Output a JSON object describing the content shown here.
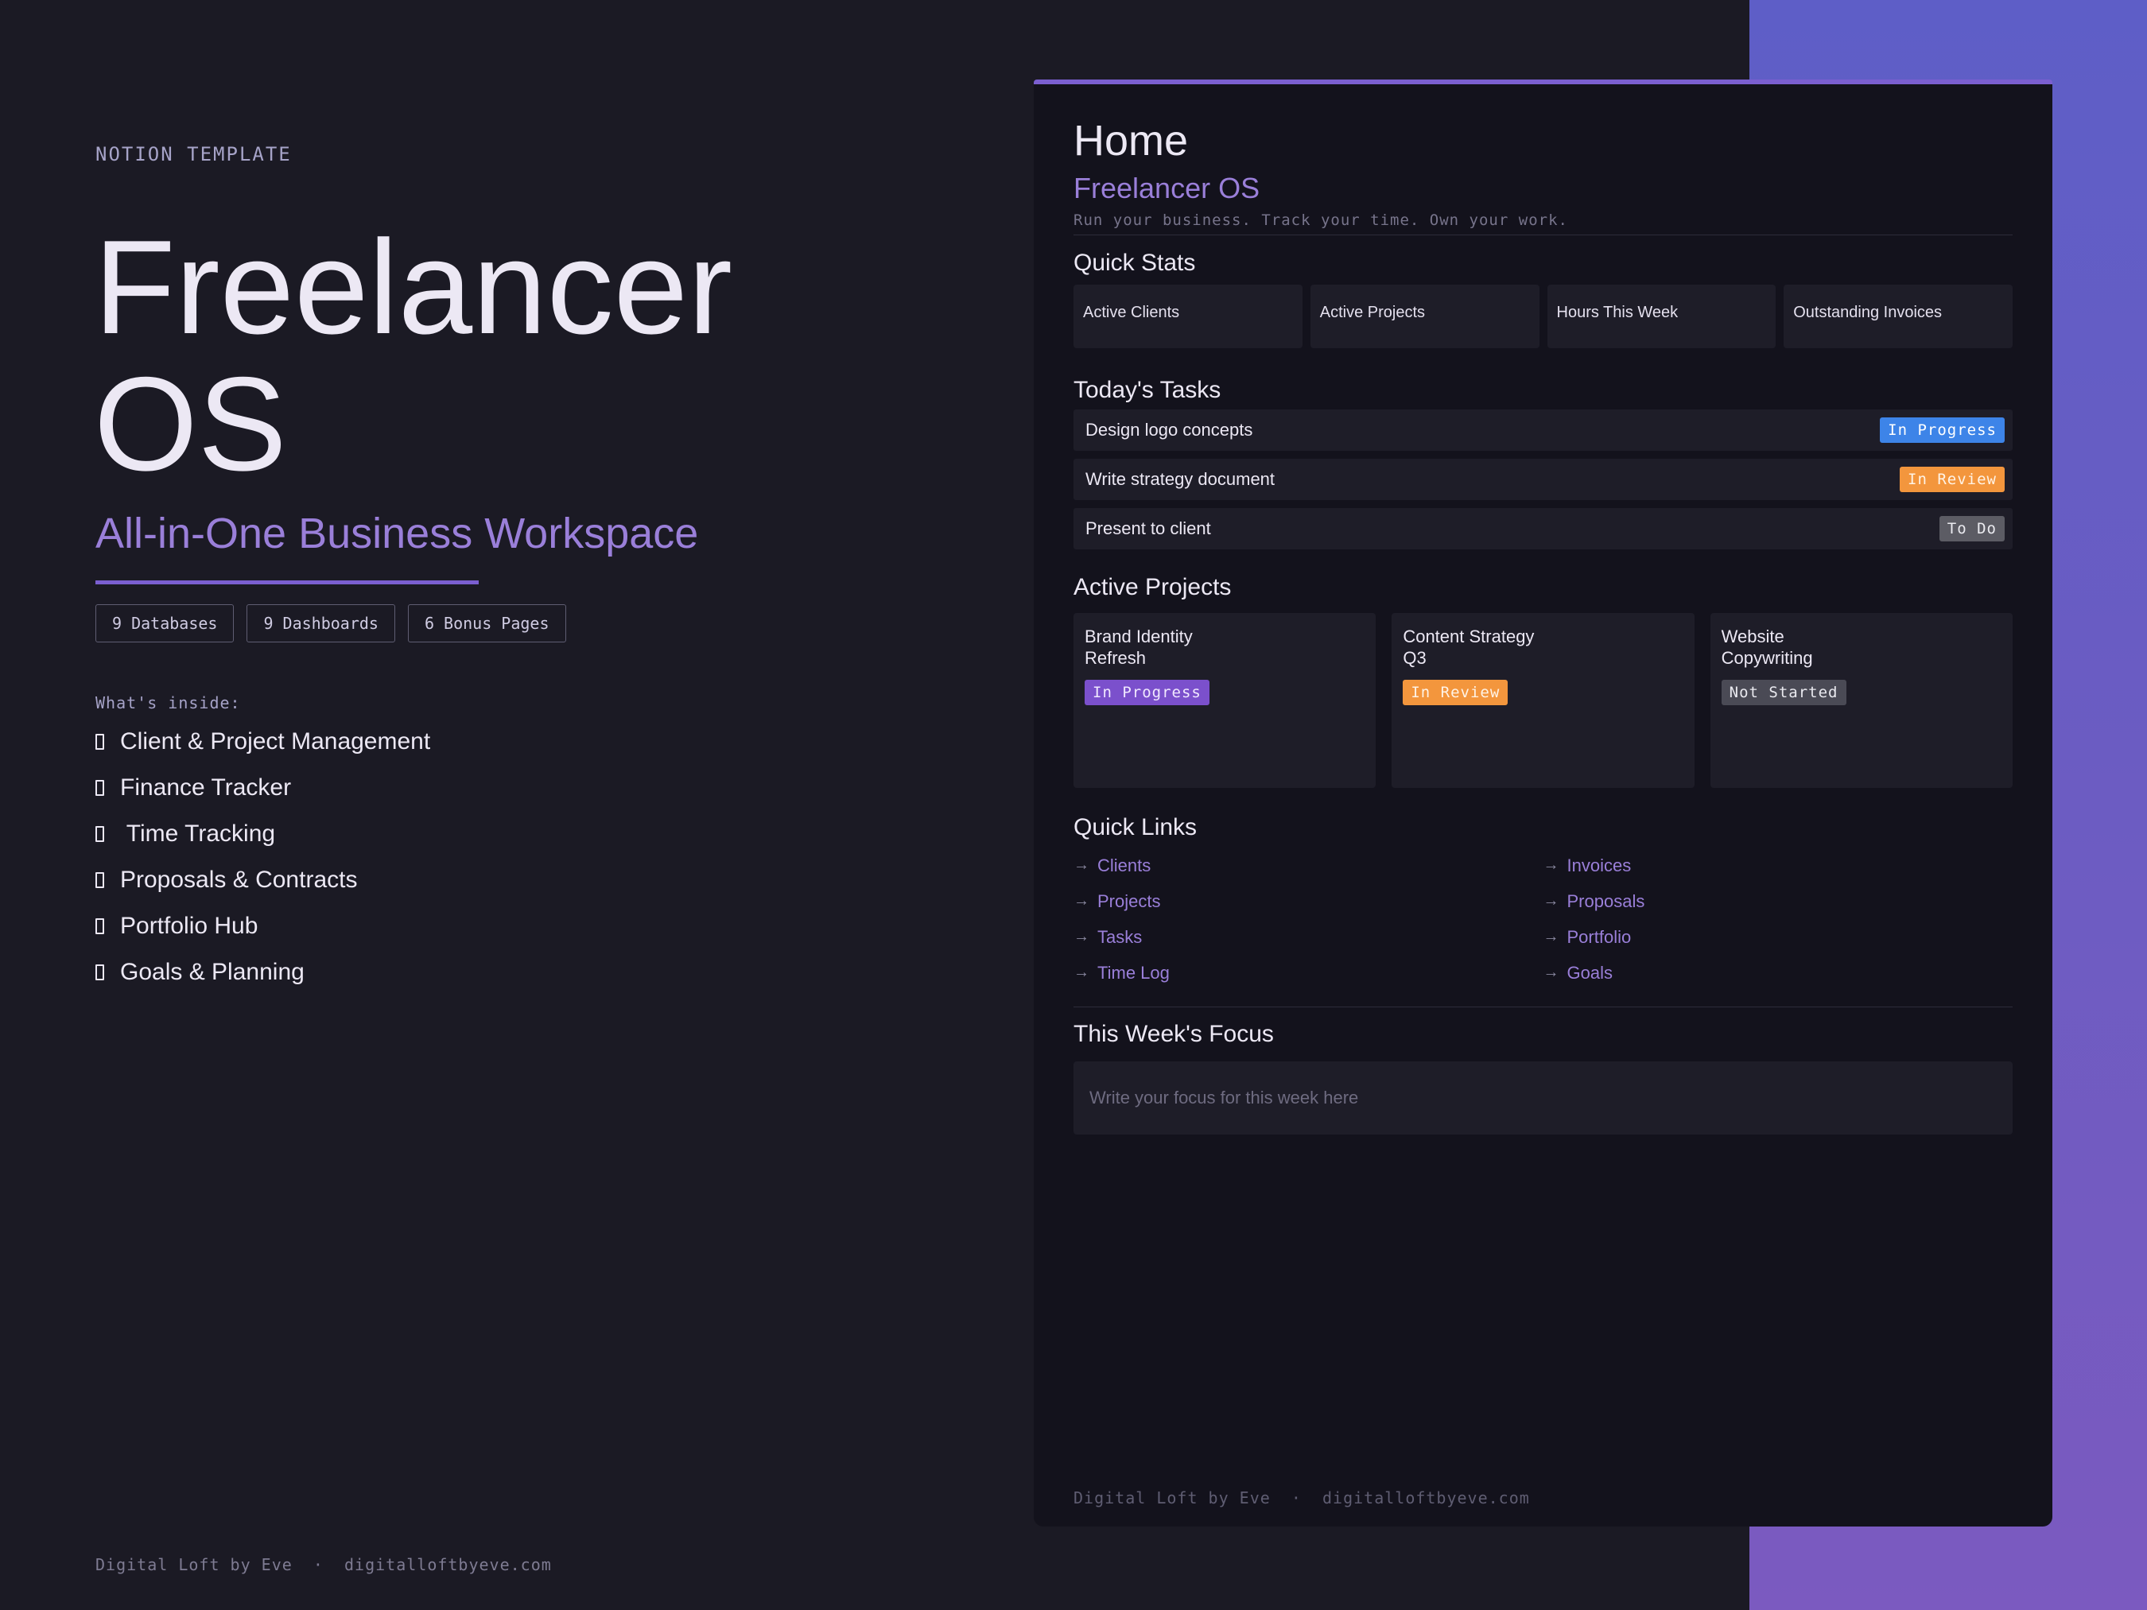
{
  "colors": {
    "accent": "#9a7fd9",
    "background": "#1b1a24",
    "panel": "#13121c",
    "gradient": "#6c5cc2"
  },
  "left": {
    "eyebrow": "NOTION TEMPLATE",
    "title_line1": "Freelancer",
    "title_line2": "OS",
    "subtitle": "All-in-One Business Workspace",
    "badges": [
      "9 Databases",
      "9 Dashboards",
      "6 Bonus Pages"
    ],
    "inside_label": "What's inside:",
    "features": [
      "Client & Project Management",
      "Finance Tracker",
      " Time Tracking",
      "Proposals & Contracts",
      "Portfolio Hub",
      "Goals & Planning"
    ],
    "footer": "Digital Loft by Eve  ·  digitalloftbyeve.com"
  },
  "panel": {
    "title": "Home",
    "subtitle": "Freelancer OS",
    "tagline": "Run your business. Track your time. Own your work.",
    "quick_stats": {
      "title": "Quick Stats",
      "items": [
        "Active Clients",
        "Active Projects",
        "Hours This Week",
        "Outstanding Invoices"
      ]
    },
    "tasks": {
      "title": "Today's Tasks",
      "items": [
        {
          "name": "Design logo concepts",
          "status": "In Progress"
        },
        {
          "name": "Write strategy document",
          "status": "In Review"
        },
        {
          "name": "Present to client",
          "status": "To Do"
        }
      ]
    },
    "projects": {
      "title": "Active Projects",
      "items": [
        {
          "name": "Brand Identity Refresh",
          "status": "In Progress"
        },
        {
          "name": "Content Strategy Q3",
          "status": "In Review"
        },
        {
          "name": "Website Copywriting",
          "status": "Not Started"
        }
      ]
    },
    "links": {
      "title": "Quick Links",
      "left": [
        "Clients",
        "Projects",
        "Tasks",
        "Time Log"
      ],
      "right": [
        "Invoices",
        "Proposals",
        "Portfolio",
        "Goals"
      ]
    },
    "focus": {
      "title": "This Week's Focus",
      "placeholder": "Write your focus for this week here",
      "value": ""
    },
    "footer": "Digital Loft by Eve  ·  digitalloftbyeve.com"
  }
}
